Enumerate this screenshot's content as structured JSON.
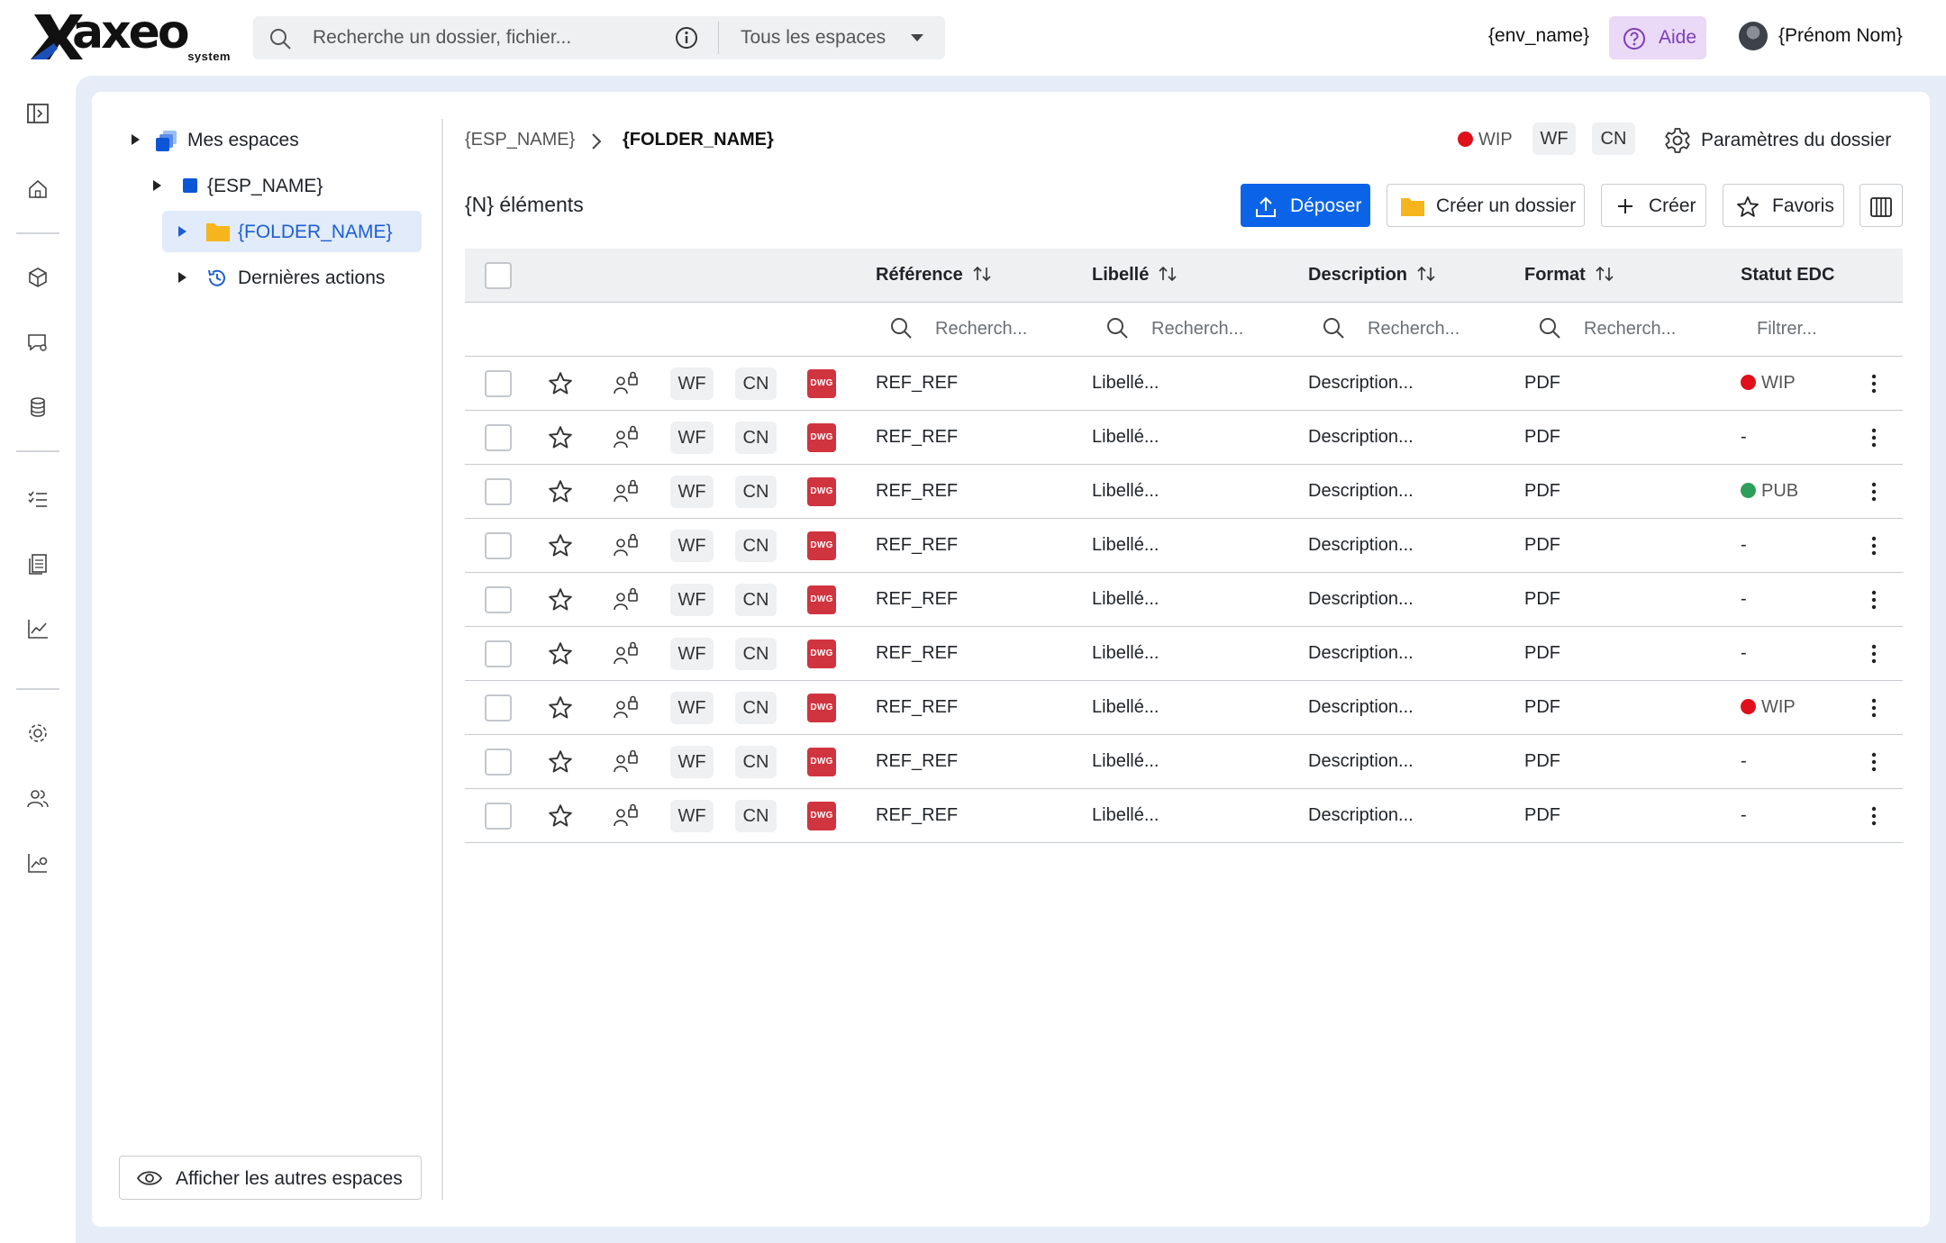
{
  "brand": {
    "name": "axeo",
    "tagline": "system"
  },
  "search": {
    "placeholder": "Recherche un dossier, fichier...",
    "scope": "Tous les espaces"
  },
  "header": {
    "env": "{env_name}",
    "help": "Aide",
    "user": "{Prénom Nom}"
  },
  "tree": {
    "items": [
      {
        "label": "Mes espaces"
      },
      {
        "label": "{ESP_NAME}"
      },
      {
        "label": "{FOLDER_NAME}",
        "selected": true
      },
      {
        "label": "Dernières actions"
      }
    ],
    "footer_button": "Afficher les autres espaces"
  },
  "breadcrumb": {
    "space": "{ESP_NAME}",
    "folder": "{FOLDER_NAME}"
  },
  "folder_status": {
    "status": "WIP",
    "status_color": "#e0101a",
    "chips": [
      "WF",
      "CN"
    ],
    "settings": "Paramètres du dossier"
  },
  "toolbar": {
    "count": "{N} éléments",
    "upload": "Déposer",
    "create_folder": "Créer un dossier",
    "create": "Créer",
    "favorites": "Favoris"
  },
  "table": {
    "columns": [
      "Référence",
      "Libellé",
      "Description",
      "Format",
      "Statut EDC"
    ],
    "filters": {
      "search": "Recherch...",
      "status": "Filtrer..."
    },
    "rows": [
      {
        "wf": "WF",
        "cn": "CN",
        "file": "DWG",
        "ref": "REF_REF",
        "label": "Libellé...",
        "desc": "Description...",
        "format": "PDF",
        "status": "WIP",
        "status_color": "#e0101a"
      },
      {
        "wf": "WF",
        "cn": "CN",
        "file": "DWG",
        "ref": "REF_REF",
        "label": "Libellé...",
        "desc": "Description...",
        "format": "PDF",
        "status": "-",
        "status_color": ""
      },
      {
        "wf": "WF",
        "cn": "CN",
        "file": "DWG",
        "ref": "REF_REF",
        "label": "Libellé...",
        "desc": "Description...",
        "format": "PDF",
        "status": "PUB",
        "status_color": "#2e9e5b"
      },
      {
        "wf": "WF",
        "cn": "CN",
        "file": "DWG",
        "ref": "REF_REF",
        "label": "Libellé...",
        "desc": "Description...",
        "format": "PDF",
        "status": "-",
        "status_color": ""
      },
      {
        "wf": "WF",
        "cn": "CN",
        "file": "DWG",
        "ref": "REF_REF",
        "label": "Libellé...",
        "desc": "Description...",
        "format": "PDF",
        "status": "-",
        "status_color": ""
      },
      {
        "wf": "WF",
        "cn": "CN",
        "file": "DWG",
        "ref": "REF_REF",
        "label": "Libellé...",
        "desc": "Description...",
        "format": "PDF",
        "status": "-",
        "status_color": ""
      },
      {
        "wf": "WF",
        "cn": "CN",
        "file": "DWG",
        "ref": "REF_REF",
        "label": "Libellé...",
        "desc": "Description...",
        "format": "PDF",
        "status": "WIP",
        "status_color": "#e0101a"
      },
      {
        "wf": "WF",
        "cn": "CN",
        "file": "DWG",
        "ref": "REF_REF",
        "label": "Libellé...",
        "desc": "Description...",
        "format": "PDF",
        "status": "-",
        "status_color": ""
      },
      {
        "wf": "WF",
        "cn": "CN",
        "file": "DWG",
        "ref": "REF_REF",
        "label": "Libellé...",
        "desc": "Description...",
        "format": "PDF",
        "status": "-",
        "status_color": ""
      }
    ]
  },
  "rail_icons": [
    "collapse-panel-icon",
    "home-icon",
    "cube-icon",
    "chat-settings-icon",
    "database-icon",
    "checklist-icon",
    "documents-icon",
    "chart-icon",
    "settings-icon",
    "users-icon",
    "analytics-settings-icon"
  ],
  "colors": {
    "primary": "#0b64e8",
    "selection": "#e1ebfa",
    "workspace_bg": "#e6edf8",
    "help_bg": "#ead9f7",
    "help_text": "#7b3fb4",
    "file_badge": "#d0343f"
  }
}
